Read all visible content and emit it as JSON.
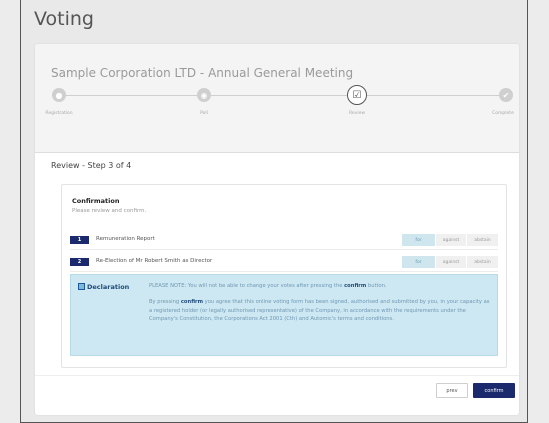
{
  "page": {
    "title": "Voting"
  },
  "meeting": {
    "title": "Sample Corporation LTD - Annual General Meeting"
  },
  "stepper": {
    "steps": [
      {
        "label": "Registration",
        "state": "done"
      },
      {
        "label": "Poll",
        "state": "done"
      },
      {
        "label": "Review",
        "state": "current"
      },
      {
        "label": "Complete",
        "state": "todo"
      }
    ]
  },
  "review": {
    "heading": "Review - Step 3 of 4"
  },
  "confirmation": {
    "title": "Confirmation",
    "subtitle": "Please review and confirm."
  },
  "resolutions": [
    {
      "number": "1",
      "label": "Remuneration Report",
      "options": {
        "for": "for",
        "against": "against",
        "abstain": "abstain"
      },
      "selected": "for"
    },
    {
      "number": "2",
      "label": "Re-Election of Mr Robert Smith as Director",
      "options": {
        "for": "for",
        "against": "against",
        "abstain": "abstain"
      },
      "selected": "for"
    }
  ],
  "declaration": {
    "title": "Declaration",
    "note_pre": "PLEASE NOTE: You will not be able to change your votes after pressing the ",
    "note_bold": "confirm",
    "note_post": " button.",
    "body_pre": "By pressing ",
    "body_bold": "confirm",
    "body_post": " you agree that this online voting form has been signed, authorised and submitted by you, in your capacity as a registered holder (or legally authorised representative) of the Company, in accordance with the requirements under the Company's Constitution, the Corporations Act 2001 (Cth) and Automic's terms and conditions."
  },
  "buttons": {
    "prev": "prev",
    "confirm": "confirm"
  },
  "colors": {
    "accent": "#1a2a6c",
    "selected_vote": "#cfe6ef",
    "declaration_bg": "#cde8f2"
  }
}
